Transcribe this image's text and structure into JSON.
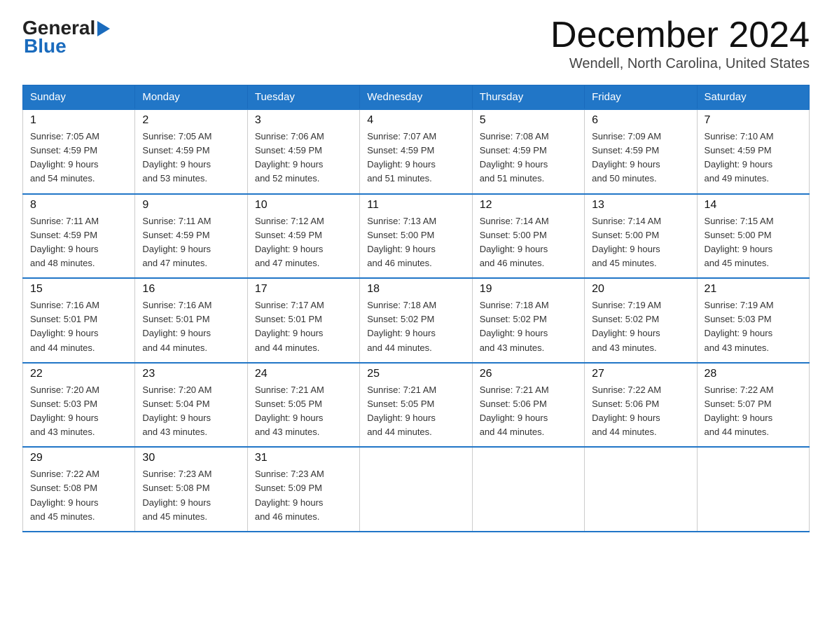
{
  "logo": {
    "general": "General",
    "arrow": "▶",
    "blue": "Blue"
  },
  "title": "December 2024",
  "location": "Wendell, North Carolina, United States",
  "headers": [
    "Sunday",
    "Monday",
    "Tuesday",
    "Wednesday",
    "Thursday",
    "Friday",
    "Saturday"
  ],
  "weeks": [
    [
      {
        "day": "1",
        "sunrise": "7:05 AM",
        "sunset": "4:59 PM",
        "daylight": "9 hours and 54 minutes."
      },
      {
        "day": "2",
        "sunrise": "7:05 AM",
        "sunset": "4:59 PM",
        "daylight": "9 hours and 53 minutes."
      },
      {
        "day": "3",
        "sunrise": "7:06 AM",
        "sunset": "4:59 PM",
        "daylight": "9 hours and 52 minutes."
      },
      {
        "day": "4",
        "sunrise": "7:07 AM",
        "sunset": "4:59 PM",
        "daylight": "9 hours and 51 minutes."
      },
      {
        "day": "5",
        "sunrise": "7:08 AM",
        "sunset": "4:59 PM",
        "daylight": "9 hours and 51 minutes."
      },
      {
        "day": "6",
        "sunrise": "7:09 AM",
        "sunset": "4:59 PM",
        "daylight": "9 hours and 50 minutes."
      },
      {
        "day": "7",
        "sunrise": "7:10 AM",
        "sunset": "4:59 PM",
        "daylight": "9 hours and 49 minutes."
      }
    ],
    [
      {
        "day": "8",
        "sunrise": "7:11 AM",
        "sunset": "4:59 PM",
        "daylight": "9 hours and 48 minutes."
      },
      {
        "day": "9",
        "sunrise": "7:11 AM",
        "sunset": "4:59 PM",
        "daylight": "9 hours and 47 minutes."
      },
      {
        "day": "10",
        "sunrise": "7:12 AM",
        "sunset": "4:59 PM",
        "daylight": "9 hours and 47 minutes."
      },
      {
        "day": "11",
        "sunrise": "7:13 AM",
        "sunset": "5:00 PM",
        "daylight": "9 hours and 46 minutes."
      },
      {
        "day": "12",
        "sunrise": "7:14 AM",
        "sunset": "5:00 PM",
        "daylight": "9 hours and 46 minutes."
      },
      {
        "day": "13",
        "sunrise": "7:14 AM",
        "sunset": "5:00 PM",
        "daylight": "9 hours and 45 minutes."
      },
      {
        "day": "14",
        "sunrise": "7:15 AM",
        "sunset": "5:00 PM",
        "daylight": "9 hours and 45 minutes."
      }
    ],
    [
      {
        "day": "15",
        "sunrise": "7:16 AM",
        "sunset": "5:01 PM",
        "daylight": "9 hours and 44 minutes."
      },
      {
        "day": "16",
        "sunrise": "7:16 AM",
        "sunset": "5:01 PM",
        "daylight": "9 hours and 44 minutes."
      },
      {
        "day": "17",
        "sunrise": "7:17 AM",
        "sunset": "5:01 PM",
        "daylight": "9 hours and 44 minutes."
      },
      {
        "day": "18",
        "sunrise": "7:18 AM",
        "sunset": "5:02 PM",
        "daylight": "9 hours and 44 minutes."
      },
      {
        "day": "19",
        "sunrise": "7:18 AM",
        "sunset": "5:02 PM",
        "daylight": "9 hours and 43 minutes."
      },
      {
        "day": "20",
        "sunrise": "7:19 AM",
        "sunset": "5:02 PM",
        "daylight": "9 hours and 43 minutes."
      },
      {
        "day": "21",
        "sunrise": "7:19 AM",
        "sunset": "5:03 PM",
        "daylight": "9 hours and 43 minutes."
      }
    ],
    [
      {
        "day": "22",
        "sunrise": "7:20 AM",
        "sunset": "5:03 PM",
        "daylight": "9 hours and 43 minutes."
      },
      {
        "day": "23",
        "sunrise": "7:20 AM",
        "sunset": "5:04 PM",
        "daylight": "9 hours and 43 minutes."
      },
      {
        "day": "24",
        "sunrise": "7:21 AM",
        "sunset": "5:05 PM",
        "daylight": "9 hours and 43 minutes."
      },
      {
        "day": "25",
        "sunrise": "7:21 AM",
        "sunset": "5:05 PM",
        "daylight": "9 hours and 44 minutes."
      },
      {
        "day": "26",
        "sunrise": "7:21 AM",
        "sunset": "5:06 PM",
        "daylight": "9 hours and 44 minutes."
      },
      {
        "day": "27",
        "sunrise": "7:22 AM",
        "sunset": "5:06 PM",
        "daylight": "9 hours and 44 minutes."
      },
      {
        "day": "28",
        "sunrise": "7:22 AM",
        "sunset": "5:07 PM",
        "daylight": "9 hours and 44 minutes."
      }
    ],
    [
      {
        "day": "29",
        "sunrise": "7:22 AM",
        "sunset": "5:08 PM",
        "daylight": "9 hours and 45 minutes."
      },
      {
        "day": "30",
        "sunrise": "7:23 AM",
        "sunset": "5:08 PM",
        "daylight": "9 hours and 45 minutes."
      },
      {
        "day": "31",
        "sunrise": "7:23 AM",
        "sunset": "5:09 PM",
        "daylight": "9 hours and 46 minutes."
      },
      null,
      null,
      null,
      null
    ]
  ],
  "labels": {
    "sunrise": "Sunrise:",
    "sunset": "Sunset:",
    "daylight": "Daylight:"
  }
}
